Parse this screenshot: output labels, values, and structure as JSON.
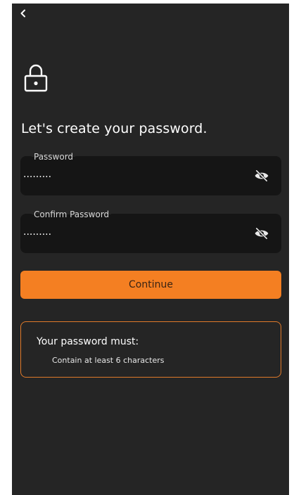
{
  "header": {
    "back_icon": "chevron-left-icon",
    "lock_icon": "lock-icon"
  },
  "title": "Let's create your password.",
  "fields": {
    "password": {
      "label": "Password",
      "value": "",
      "mask": "·········",
      "toggle_icon": "eye-off-icon"
    },
    "confirm_password": {
      "label": "Confirm Password",
      "value": "",
      "mask": "·········",
      "toggle_icon": "eye-off-icon"
    }
  },
  "continue_label": "Continue",
  "requirements": {
    "title": "Your password must:",
    "items": [
      "Contain at least 6 characters"
    ]
  },
  "colors": {
    "background": "#252525",
    "field": "#151515",
    "accent": "#f47f22"
  }
}
